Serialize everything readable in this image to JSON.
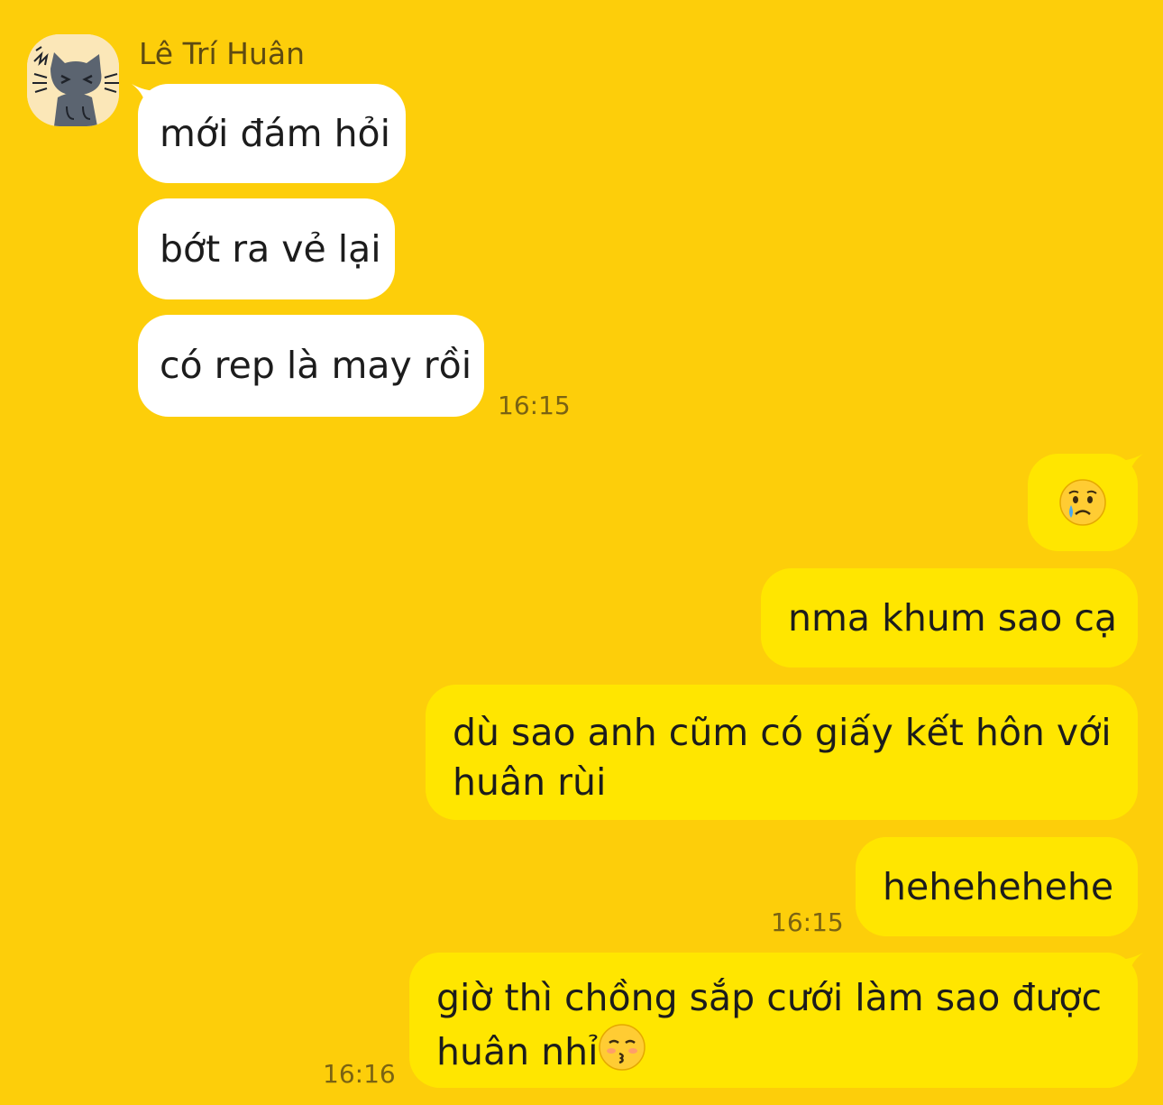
{
  "contact": {
    "name": "Lê Trí Huân",
    "avatar_icon": "cat-avatar-icon"
  },
  "incoming": [
    {
      "text": "mới đám hỏi"
    },
    {
      "text": "bớt ra vẻ lại"
    },
    {
      "text": "có rep là may rồi"
    }
  ],
  "incoming_time": "16:15",
  "outgoing": [
    {
      "emoji": "crying-face-emoji"
    },
    {
      "text": "nma khum sao cạ"
    },
    {
      "line1": "dù sao anh cũm có giấy kết hôn với",
      "line2": "huân rùi"
    },
    {
      "text": "hehehehehe"
    },
    {
      "line1": "giờ thì chồng sắp cưới làm sao được",
      "line2": "huân nhỉ",
      "emoji": "kissing-face-emoji"
    }
  ],
  "outgoing_times": [
    "16:15",
    "16:16"
  ],
  "colors": {
    "background": "#FDCE0A",
    "incoming_bubble": "#FFFFFF",
    "outgoing_bubble": "#FFE600",
    "text": "#1C1C1C",
    "timestamp": "#7A6313"
  }
}
